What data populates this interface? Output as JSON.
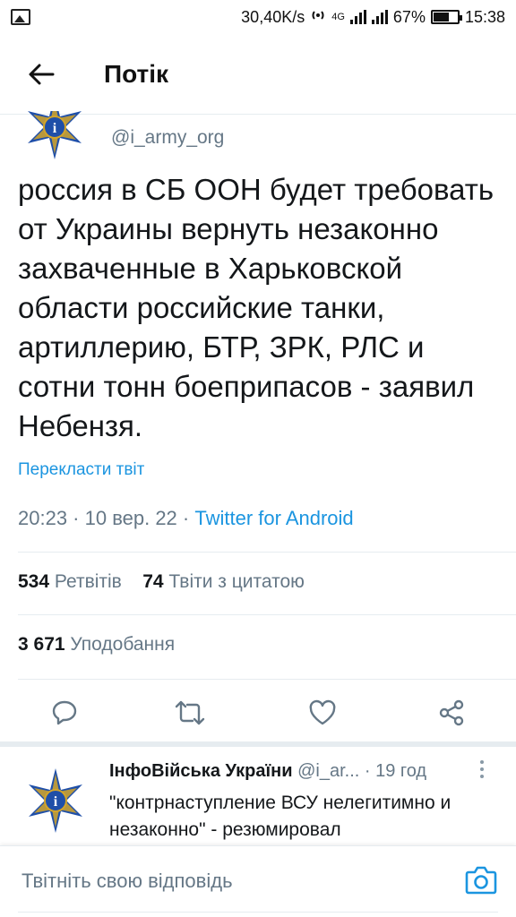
{
  "status_bar": {
    "speed": "30,40K/s",
    "network": "4G",
    "battery": "67%",
    "time": "15:38"
  },
  "header": {
    "title": "Потік"
  },
  "tweet": {
    "handle": "@i_army_org",
    "text": "россия в СБ ООН будет требовать от Украины вернуть незаконно захваченные в Харьковской области российские танки, артиллерию, БТР, ЗРК, РЛС и сотни тонн боеприпасов - заявил Небензя.",
    "translate_label": "Перекласти твіт",
    "timestamp": "20:23 · 10 вер. 22 · ",
    "source": "Twitter for Android",
    "retweets_count": "534",
    "retweets_label": "Ретвітів",
    "quotes_count": "74",
    "quotes_label": "Твіти з цитатою",
    "likes_count": "3 671",
    "likes_label": "Уподобання"
  },
  "reply": {
    "name": "ІнфоВійська України",
    "handle": "@i_ar...",
    "time": "· 19 год",
    "text": "\"контрнаступление ВСУ нелегитимно и незаконно\" - резюмировал"
  },
  "composer": {
    "placeholder": "Твітніть свою відповідь"
  },
  "colors": {
    "accent": "#1b95e0",
    "muted": "#657786",
    "divider": "#e6ecf0",
    "emblem_blue": "#1f4fa8",
    "emblem_gold": "#d4a52a"
  }
}
